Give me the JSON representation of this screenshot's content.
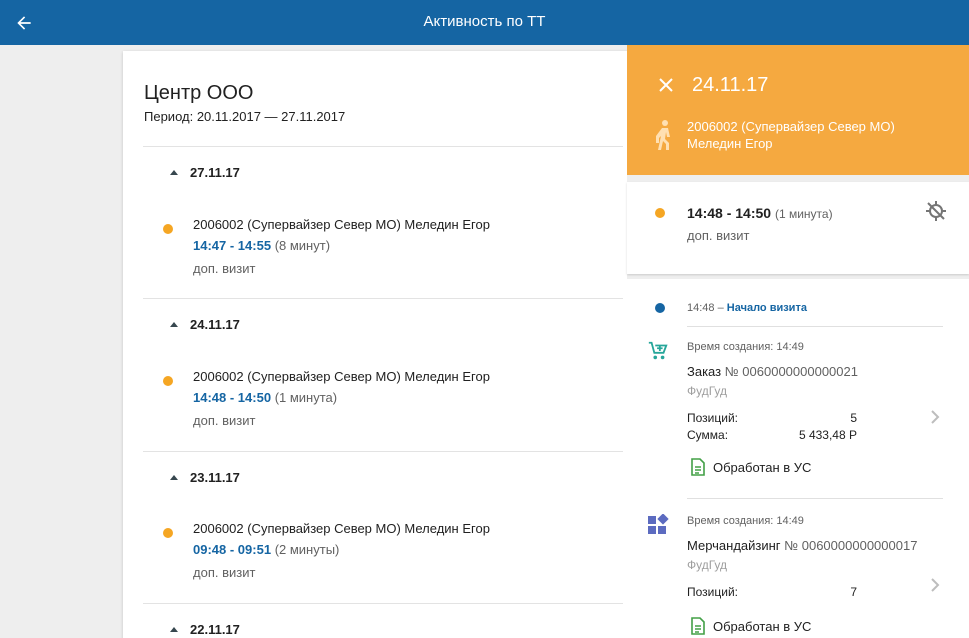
{
  "header": {
    "title": "Активность по ТТ"
  },
  "outlet": {
    "name": "Центр ООО",
    "period": "Период: 20.11.2017 — 27.11.2017"
  },
  "days": [
    {
      "date": "27.11.17",
      "visit": {
        "who": "2006002 (Супервайзер Север МО) Меледин Егор",
        "time": "14:47 - 14:55",
        "duration": "(8 минут)",
        "kind": "доп. визит"
      }
    },
    {
      "date": "24.11.17",
      "visit": {
        "who": "2006002 (Супервайзер Север МО) Меледин Егор",
        "time": "14:48 - 14:50",
        "duration": "(1 минута)",
        "kind": "доп. визит"
      }
    },
    {
      "date": "23.11.17",
      "visit": {
        "who": "2006002 (Супервайзер Север МО) Меледин Егор",
        "time": "09:48 - 09:51",
        "duration": "(2 минуты)",
        "kind": "доп. визит"
      }
    },
    {
      "date": "22.11.17"
    }
  ],
  "panel": {
    "date": "24.11.17",
    "agent_line1": "2006002 (Супервайзер Север МО)",
    "agent_line2": "Меледин Егор",
    "visit_time": "14:48 - 14:50",
    "visit_duration": "(1 минута)",
    "visit_kind": "доп. визит",
    "event_time": "14:48",
    "event_sep": "–",
    "event_label": "Начало визита",
    "docs": [
      {
        "icon": "cart-add-icon",
        "created": "Время создания: 14:49",
        "title": "Заказ",
        "number": "№ 0060000000000021",
        "org": "ФудГуд",
        "positions_label": "Позиций:",
        "positions": "5",
        "sum_label": "Сумма:",
        "sum": "5 433,48 Р",
        "status": "Обработан в УС"
      },
      {
        "icon": "merchandising-icon",
        "created": "Время создания: 14:49",
        "title": "Мерчандайзинг",
        "number": "№ 0060000000000017",
        "org": "ФудГуд",
        "positions_label": "Позиций:",
        "positions": "7",
        "status": "Обработан в УС"
      }
    ]
  },
  "colors": {
    "primary": "#1565a3",
    "accent": "#f5a940",
    "visit_dot": "#f5a623",
    "status_green": "#43a047"
  }
}
